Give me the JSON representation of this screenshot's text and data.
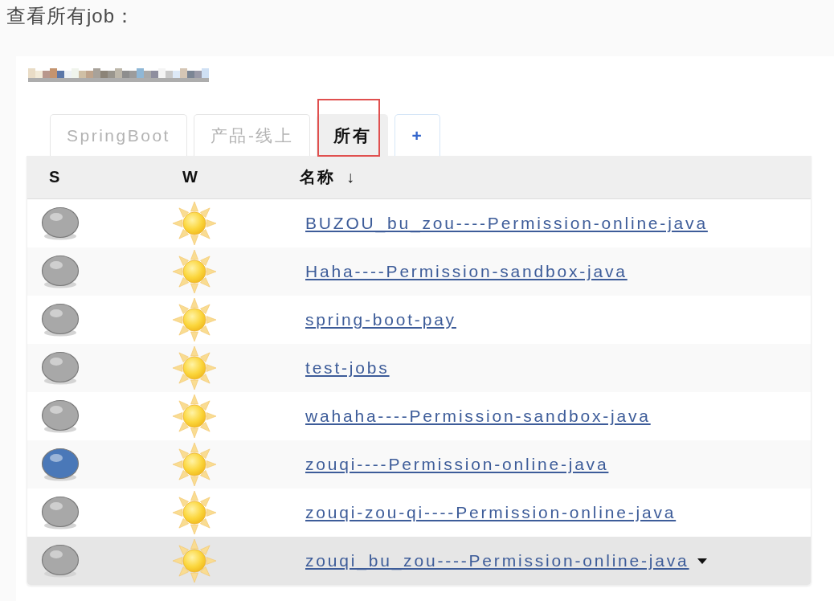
{
  "heading": "查看所有job：",
  "tabs": [
    {
      "kind": "view",
      "label": "SpringBoot",
      "selected": false,
      "highlighted": false
    },
    {
      "kind": "view",
      "label": "产品-线上",
      "selected": false,
      "highlighted": false
    },
    {
      "kind": "view",
      "label": "所有",
      "selected": true,
      "highlighted": true
    },
    {
      "kind": "add",
      "label": "+",
      "selected": false,
      "highlighted": false
    }
  ],
  "table": {
    "columns": [
      {
        "label": "S"
      },
      {
        "label": "W"
      },
      {
        "label": "名称",
        "sort_arrow": "↓"
      }
    ],
    "rows": [
      {
        "color": "#a8a8a8",
        "name": "BUZOU_bu_zou----Permission-online-java",
        "hovered": false
      },
      {
        "color": "#a8a8a8",
        "name": "Haha----Permission-sandbox-java",
        "hovered": false
      },
      {
        "color": "#a8a8a8",
        "name": "spring-boot-pay",
        "hovered": false
      },
      {
        "color": "#a8a8a8",
        "name": "test-jobs",
        "hovered": false
      },
      {
        "color": "#a8a8a8",
        "name": "wahaha----Permission-sandbox-java",
        "hovered": false
      },
      {
        "color": "#4a78b8",
        "name": "zouqi----Permission-online-java",
        "hovered": false
      },
      {
        "color": "#a8a8a8",
        "name": "zouqi-zou-qi----Permission-online-java",
        "hovered": false
      },
      {
        "color": "#a8a8a8",
        "name": "zouqi_bu_zou----Permission-online-java",
        "hovered": true
      }
    ]
  }
}
